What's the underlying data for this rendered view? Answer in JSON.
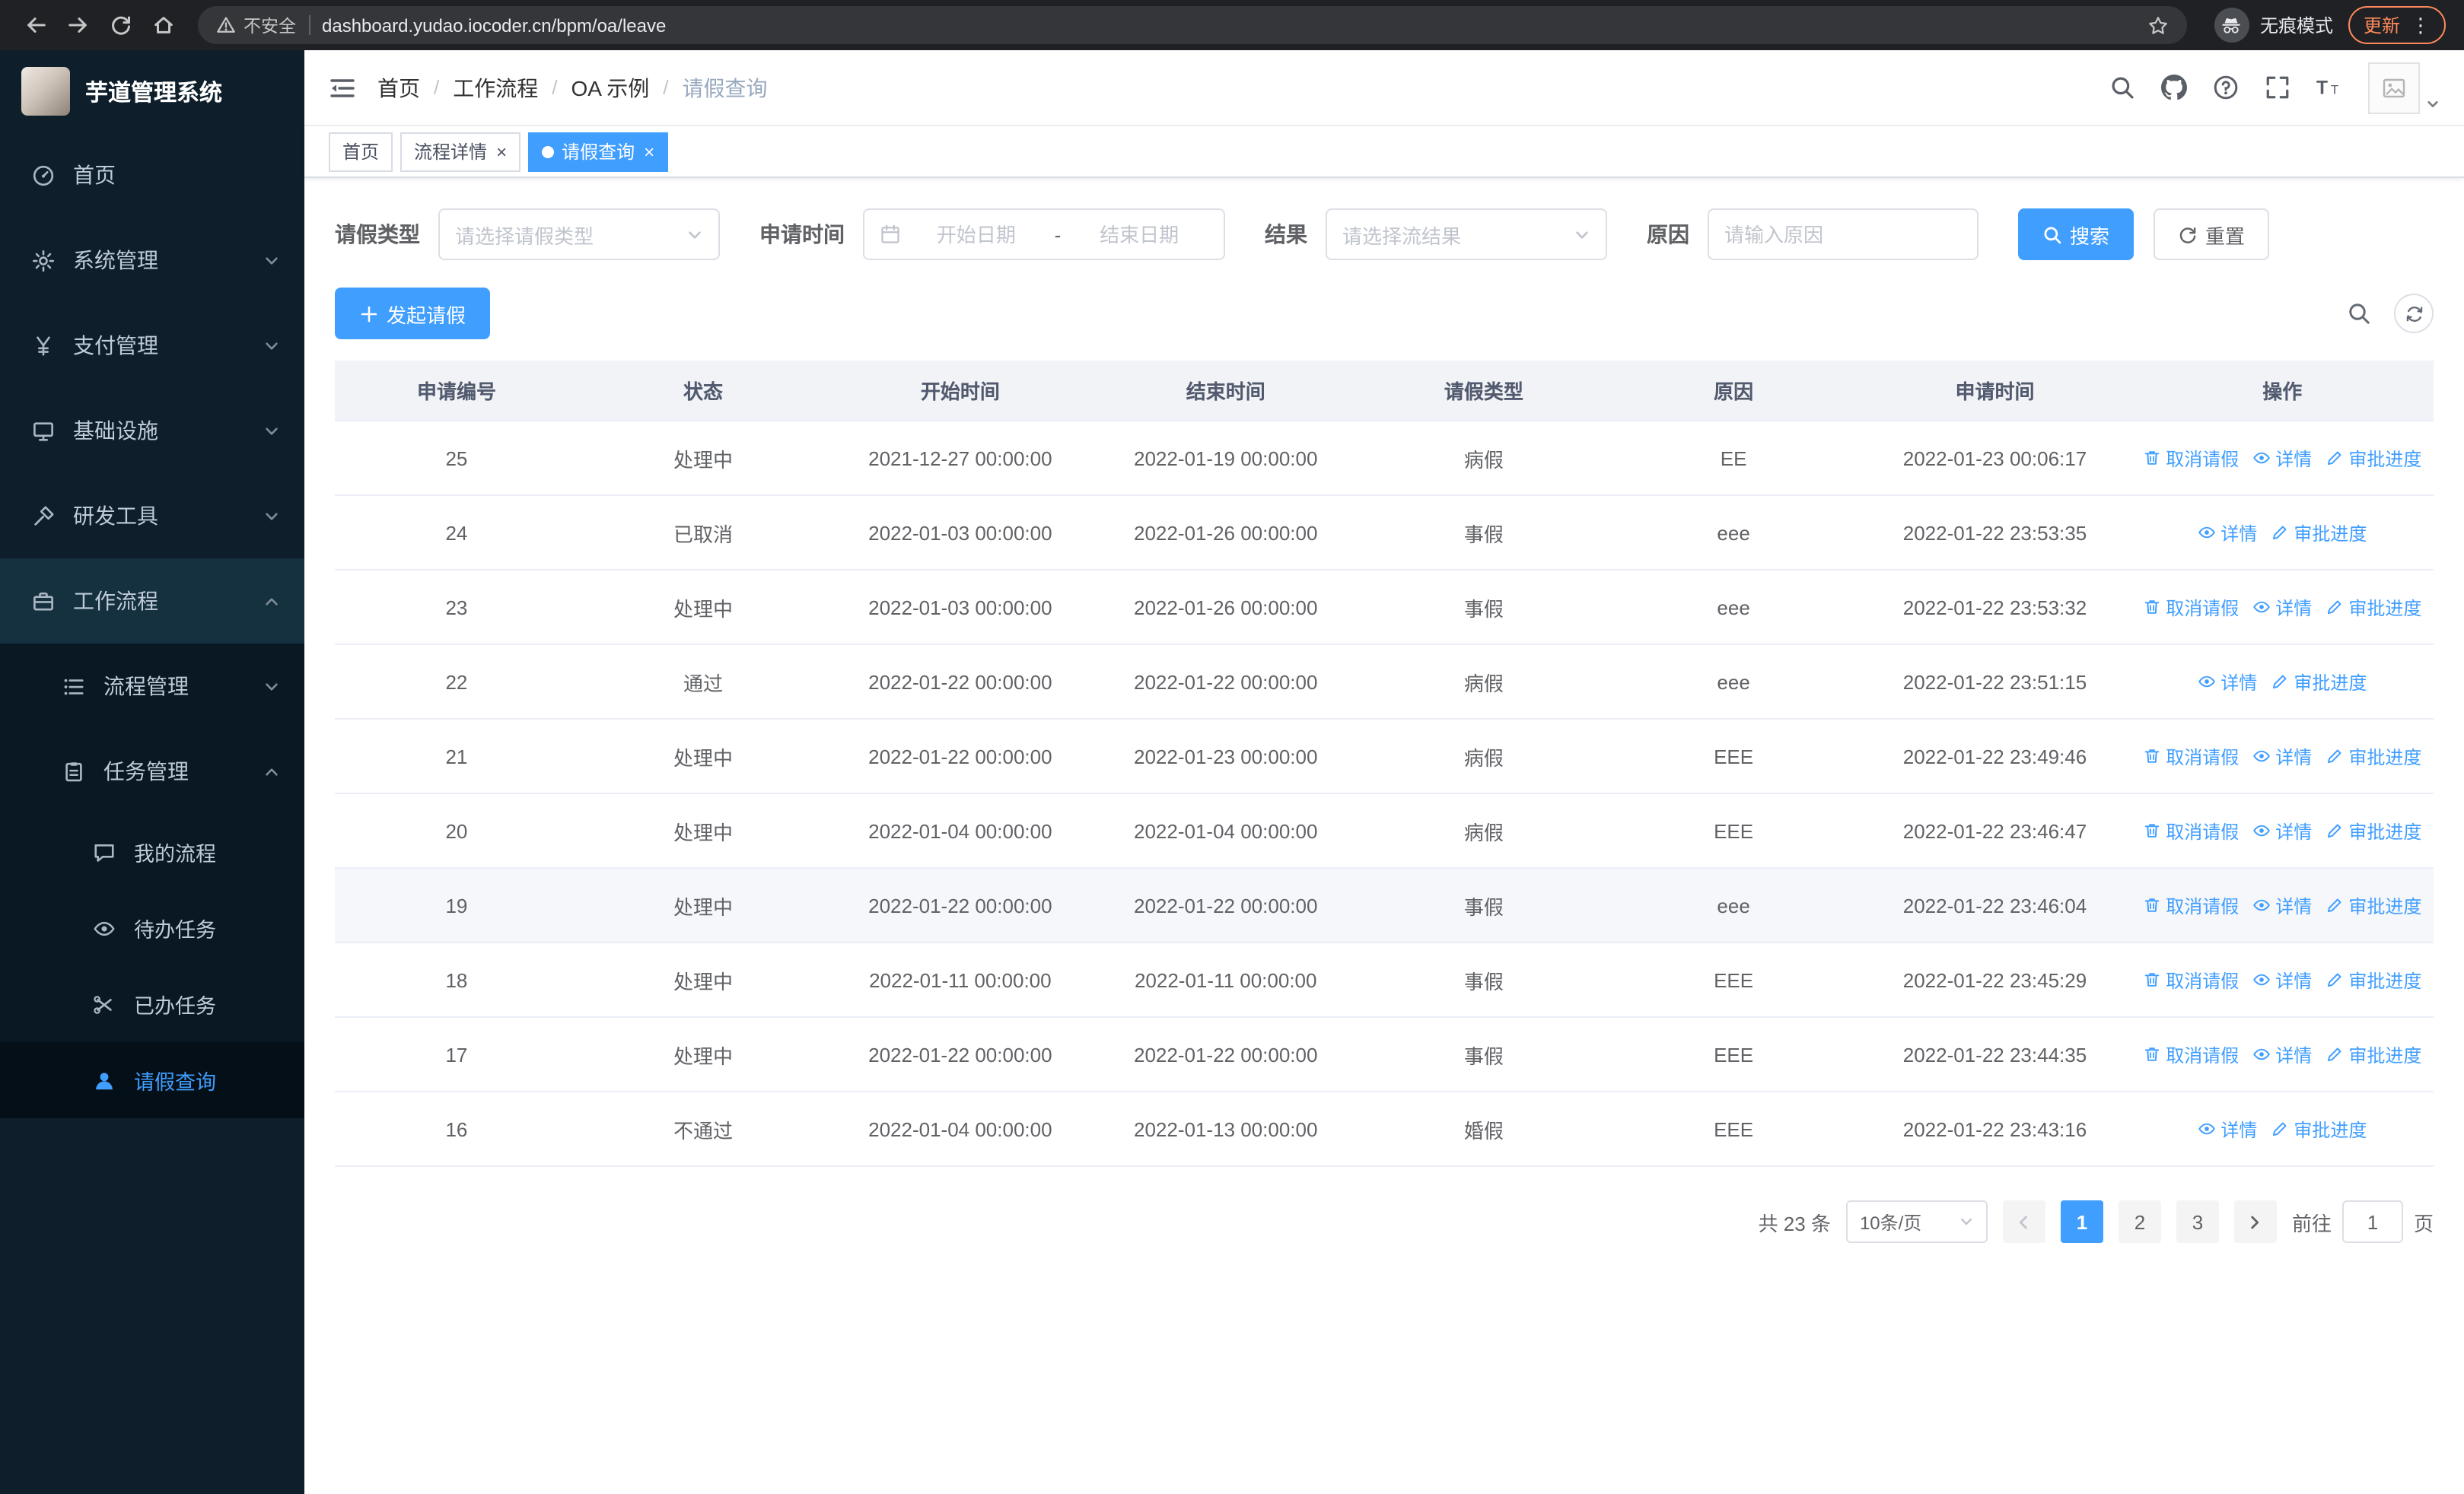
{
  "colors": {
    "primary": "#409eff",
    "chrome-bg": "#202124",
    "update-orange": "#ff8a5c",
    "sidebar-bg": "#0e1f2b",
    "sidebar-sub-bg": "#091822",
    "sidebar-active-bg": "#050f17"
  },
  "browser": {
    "security_label": "不安全",
    "url": "dashboard.yudao.iocoder.cn/bpm/oa/leave",
    "incognito_label": "无痕模式",
    "update_label": "更新"
  },
  "sidebar": {
    "logo_title": "芋道管理系统",
    "menu": [
      {
        "label": "首页",
        "icon": "dashboard",
        "level": 1
      },
      {
        "label": "系统管理",
        "icon": "gear",
        "level": 1,
        "chevron": "down"
      },
      {
        "label": "支付管理",
        "icon": "yen",
        "level": 1,
        "chevron": "down"
      },
      {
        "label": "基础设施",
        "icon": "infra",
        "level": 1,
        "chevron": "down"
      },
      {
        "label": "研发工具",
        "icon": "tools",
        "level": 1,
        "chevron": "down"
      },
      {
        "label": "工作流程",
        "icon": "workflow",
        "level": 1,
        "chevron": "up",
        "highlight": true
      },
      {
        "label": "流程管理",
        "icon": "process",
        "level": 2,
        "chevron": "down"
      },
      {
        "label": "任务管理",
        "icon": "task",
        "level": 2,
        "chevron": "up"
      },
      {
        "label": "我的流程",
        "icon": "chat",
        "level": 3
      },
      {
        "label": "待办任务",
        "icon": "eye",
        "level": 3
      },
      {
        "label": "已办任务",
        "icon": "done",
        "level": 3
      },
      {
        "label": "请假查询",
        "icon": "user",
        "level": 3,
        "active": true
      }
    ]
  },
  "navbar": {
    "breadcrumb": [
      "首页",
      "工作流程",
      "OA 示例",
      "请假查询"
    ]
  },
  "tabs": [
    {
      "label": "首页",
      "closable": false,
      "active": false
    },
    {
      "label": "流程详情",
      "closable": true,
      "active": false
    },
    {
      "label": "请假查询",
      "closable": true,
      "active": true
    }
  ],
  "filters": {
    "leave_type_label": "请假类型",
    "leave_type_placeholder": "请选择请假类型",
    "apply_time_label": "申请时间",
    "date_start_placeholder": "开始日期",
    "date_separator": "-",
    "date_end_placeholder": "结束日期",
    "result_label": "结果",
    "result_placeholder": "请选择流结果",
    "reason_label": "原因",
    "reason_placeholder": "请输入原因",
    "search_button": "搜索",
    "reset_button": "重置"
  },
  "toolbar": {
    "create_button": "发起请假"
  },
  "table": {
    "headers": [
      "申请编号",
      "状态",
      "开始时间",
      "结束时间",
      "请假类型",
      "原因",
      "申请时间",
      "操作"
    ],
    "actions": {
      "cancel": "取消请假",
      "detail": "详情",
      "progress": "审批进度"
    },
    "rows": [
      {
        "id": "25",
        "status": "处理中",
        "start": "2021-12-27 00:00:00",
        "end": "2022-01-19 00:00:00",
        "type": "病假",
        "reason": "EE",
        "applied": "2022-01-23 00:06:17",
        "cancelable": true
      },
      {
        "id": "24",
        "status": "已取消",
        "start": "2022-01-03 00:00:00",
        "end": "2022-01-26 00:00:00",
        "type": "事假",
        "reason": "eee",
        "applied": "2022-01-22 23:53:35",
        "cancelable": false
      },
      {
        "id": "23",
        "status": "处理中",
        "start": "2022-01-03 00:00:00",
        "end": "2022-01-26 00:00:00",
        "type": "事假",
        "reason": "eee",
        "applied": "2022-01-22 23:53:32",
        "cancelable": true
      },
      {
        "id": "22",
        "status": "通过",
        "start": "2022-01-22 00:00:00",
        "end": "2022-01-22 00:00:00",
        "type": "病假",
        "reason": "eee",
        "applied": "2022-01-22 23:51:15",
        "cancelable": false
      },
      {
        "id": "21",
        "status": "处理中",
        "start": "2022-01-22 00:00:00",
        "end": "2022-01-23 00:00:00",
        "type": "病假",
        "reason": "EEE",
        "applied": "2022-01-22 23:49:46",
        "cancelable": true
      },
      {
        "id": "20",
        "status": "处理中",
        "start": "2022-01-04 00:00:00",
        "end": "2022-01-04 00:00:00",
        "type": "病假",
        "reason": "EEE",
        "applied": "2022-01-22 23:46:47",
        "cancelable": true
      },
      {
        "id": "19",
        "status": "处理中",
        "start": "2022-01-22 00:00:00",
        "end": "2022-01-22 00:00:00",
        "type": "事假",
        "reason": "eee",
        "applied": "2022-01-22 23:46:04",
        "cancelable": true,
        "highlight": true
      },
      {
        "id": "18",
        "status": "处理中",
        "start": "2022-01-11 00:00:00",
        "end": "2022-01-11 00:00:00",
        "type": "事假",
        "reason": "EEE",
        "applied": "2022-01-22 23:45:29",
        "cancelable": true
      },
      {
        "id": "17",
        "status": "处理中",
        "start": "2022-01-22 00:00:00",
        "end": "2022-01-22 00:00:00",
        "type": "事假",
        "reason": "EEE",
        "applied": "2022-01-22 23:44:35",
        "cancelable": true
      },
      {
        "id": "16",
        "status": "不通过",
        "start": "2022-01-04 00:00:00",
        "end": "2022-01-13 00:00:00",
        "type": "婚假",
        "reason": "EEE",
        "applied": "2022-01-22 23:43:16",
        "cancelable": false
      }
    ]
  },
  "pagination": {
    "total_text": "共 23 条",
    "page_size": "10条/页",
    "pages": [
      "1",
      "2",
      "3"
    ],
    "active_page": "1",
    "goto_label": "前往",
    "goto_value": "1",
    "goto_unit": "页"
  }
}
